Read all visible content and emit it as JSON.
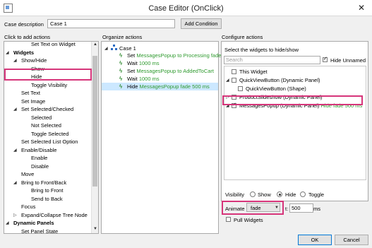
{
  "window": {
    "title": "Case Editor (OnClick)"
  },
  "case": {
    "description_label": "Case description",
    "description_value": "Case 1",
    "add_condition_label": "Add Condition"
  },
  "left": {
    "header": "Click to add actions",
    "items": [
      {
        "label": "Set Text on Widget",
        "indent": 2
      },
      {
        "label": "Widgets",
        "indent": 0,
        "bold": true,
        "arrow": "◢"
      },
      {
        "label": "Show/Hide",
        "indent": 1,
        "arrow": "◢"
      },
      {
        "label": "Show",
        "indent": 2
      },
      {
        "label": "Hide",
        "indent": 2
      },
      {
        "label": "Toggle Visibility",
        "indent": 2
      },
      {
        "label": "Set Text",
        "indent": 1
      },
      {
        "label": "Set Image",
        "indent": 1
      },
      {
        "label": "Set Selected/Checked",
        "indent": 1,
        "arrow": "◢"
      },
      {
        "label": "Selected",
        "indent": 2
      },
      {
        "label": "Not Selected",
        "indent": 2
      },
      {
        "label": "Toggle Selected",
        "indent": 2
      },
      {
        "label": "Set Selected List Option",
        "indent": 1
      },
      {
        "label": "Enable/Disable",
        "indent": 1,
        "arrow": "◢"
      },
      {
        "label": "Enable",
        "indent": 2
      },
      {
        "label": "Disable",
        "indent": 2
      },
      {
        "label": "Move",
        "indent": 1
      },
      {
        "label": "Bring to Front/Back",
        "indent": 1,
        "arrow": "◢"
      },
      {
        "label": "Bring to Front",
        "indent": 2
      },
      {
        "label": "Send to Back",
        "indent": 2
      },
      {
        "label": "Focus",
        "indent": 1
      },
      {
        "label": "Expand/Collapse Tree Node",
        "indent": 1,
        "arrow": "▷"
      },
      {
        "label": "Dynamic Panels",
        "indent": 0,
        "bold": true,
        "arrow": "◢"
      },
      {
        "label": "Set Panel State",
        "indent": 1
      }
    ]
  },
  "middle": {
    "header": "Organize actions",
    "case_label": "Case 1",
    "actions": [
      {
        "prefix": "Set",
        "target": "MessagesPopup to Processing fade in",
        "detail": ""
      },
      {
        "prefix": "Wait",
        "target": "",
        "detail": "1000 ms"
      },
      {
        "prefix": "Set",
        "target": "MessagesPopup to AddedToCart",
        "detail": ""
      },
      {
        "prefix": "Wait",
        "target": "",
        "detail": "1000 ms"
      },
      {
        "prefix": "Hide",
        "target": "MessagesPopup",
        "detail": "fade 500 ms"
      }
    ]
  },
  "right": {
    "header": "Configure actions",
    "select_label": "Select the widgets to hide/show",
    "search_placeholder": "Search",
    "hide_unnamed_label": "Hide Unnamed",
    "widgets": [
      {
        "label": "This Widget",
        "detail": "",
        "checked": false,
        "arrow": ""
      },
      {
        "label": "QuickViewButton (Dynamic Panel)",
        "detail": "",
        "checked": false,
        "arrow": "◢"
      },
      {
        "label": "QuickViewButton (Shape)",
        "detail": "",
        "checked": false,
        "arrow": ""
      },
      {
        "label": "ProductSlideshow (Dynamic Panel)",
        "detail": "",
        "checked": false,
        "arrow": "▷"
      },
      {
        "label": "MessagesPopup (Dynamic Panel)",
        "detail": "Hide fade 500 ms",
        "checked": true,
        "arrow": "◢"
      }
    ],
    "visibility_label": "Visibility",
    "visibility_options": [
      "Show",
      "Hide",
      "Toggle"
    ],
    "animate_label": "Animate",
    "animate_value": "fade",
    "t_label": "t:",
    "t_value": "500",
    "ms_label": "ms",
    "pull_widgets_label": "Pull Widgets"
  },
  "buttons": {
    "ok": "OK",
    "cancel": "Cancel"
  },
  "colors": {
    "selection": "#cce8ff",
    "highlight": "#d6357a",
    "green_text": "#2e9a2e"
  }
}
